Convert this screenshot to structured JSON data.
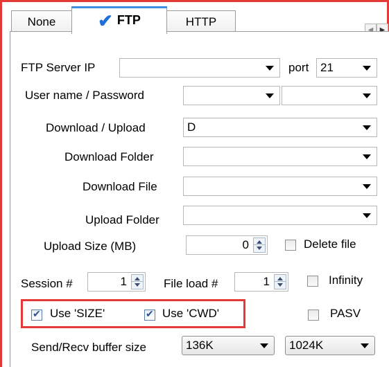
{
  "tabs": [
    {
      "label": "None"
    },
    {
      "label": "FTP",
      "active": true
    },
    {
      "label": "HTTP"
    }
  ],
  "ftp": {
    "server_ip_label": "FTP Server IP",
    "server_ip_value": "",
    "port_label": "port",
    "port_value": "21",
    "user_pass_label": "User name / Password",
    "username_value": "",
    "password_value": "",
    "down_up_label": "Download / Upload",
    "down_up_value": "D",
    "download_folder_label": "Download Folder",
    "download_folder_value": "",
    "download_file_label": "Download File",
    "download_file_value": "",
    "upload_folder_label": "Upload Folder",
    "upload_folder_value": "",
    "upload_size_label": "Upload Size (MB)",
    "upload_size_value": "0",
    "delete_file_label": "Delete file",
    "delete_file_checked": false,
    "session_label": "Session #",
    "session_value": "1",
    "file_load_label": "File load #",
    "file_load_value": "1",
    "infinity_label": "Infinity",
    "infinity_checked": false,
    "use_size_label": "Use 'SIZE'",
    "use_size_checked": true,
    "use_cwd_label": "Use 'CWD'",
    "use_cwd_checked": true,
    "pasv_label": "PASV",
    "pasv_checked": false,
    "buffer_label": "Send/Recv buffer size",
    "send_buffer_value": "136K",
    "recv_buffer_value": "1024K"
  },
  "colors": {
    "highlight": "#e53935",
    "tab_accent": "#3d8ee0"
  },
  "icons": {
    "active_tab": "check-icon"
  }
}
